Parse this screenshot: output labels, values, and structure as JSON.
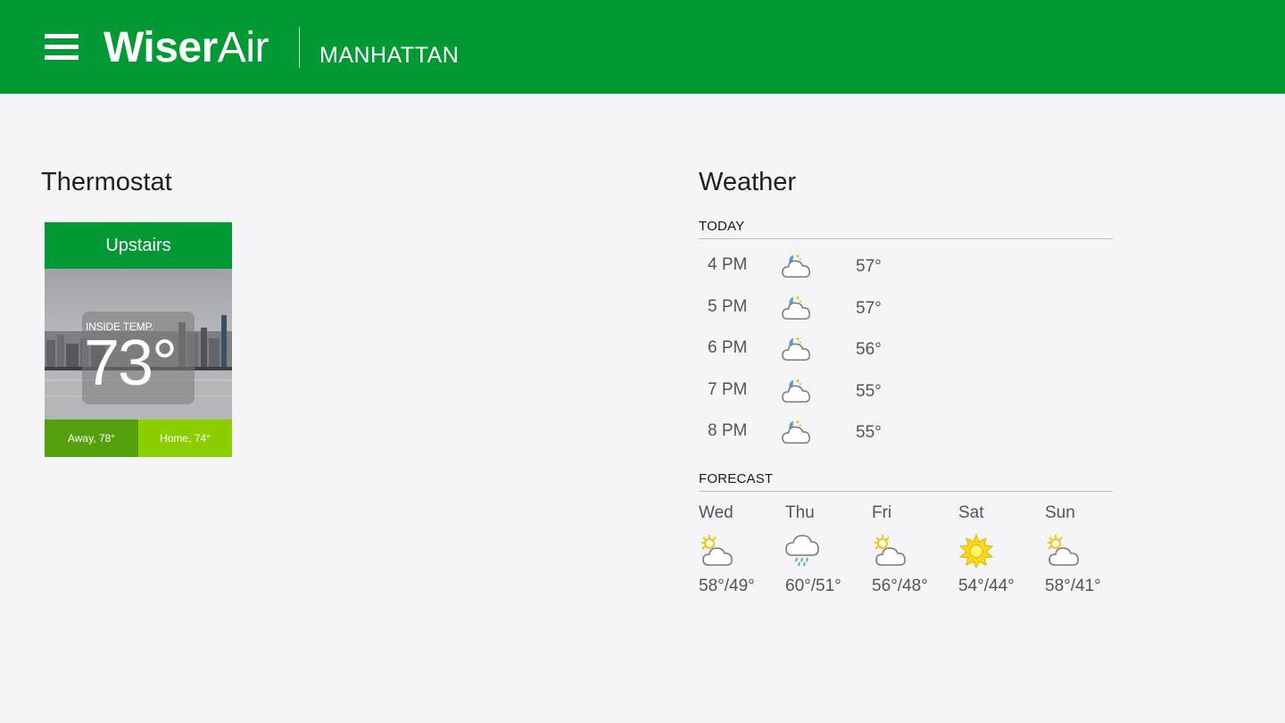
{
  "header": {
    "brand_bold": "Wiser",
    "brand_light": "Air",
    "location": "MANHATTAN",
    "menu_icon": "hamburger-menu-icon"
  },
  "colors": {
    "header_green": "#009933",
    "away_green": "#55a10d",
    "home_green": "#8ccf00",
    "background": "#f5f4f6"
  },
  "thermostat": {
    "title": "Thermostat",
    "tile": {
      "name": "Upstairs",
      "inside_label": "INSIDE TEMP.",
      "inside_temp": "73°",
      "away_label": "Away, 78°",
      "home_label": "Home, 74°"
    }
  },
  "weather": {
    "title": "Weather",
    "today_label": "TODAY",
    "hourly": [
      {
        "time": "4 PM",
        "icon": "night-partly-cloudy-icon",
        "temp": "57°"
      },
      {
        "time": "5 PM",
        "icon": "night-partly-cloudy-icon",
        "temp": "57°"
      },
      {
        "time": "6 PM",
        "icon": "night-partly-cloudy-icon",
        "temp": "56°"
      },
      {
        "time": "7 PM",
        "icon": "night-partly-cloudy-icon",
        "temp": "55°"
      },
      {
        "time": "8 PM",
        "icon": "night-partly-cloudy-icon",
        "temp": "55°"
      }
    ],
    "forecast_label": "FORECAST",
    "forecast": [
      {
        "day": "Wed",
        "icon": "partly-sunny-icon",
        "temp": "58°/49°"
      },
      {
        "day": "Thu",
        "icon": "rain-cloud-icon",
        "temp": "60°/51°"
      },
      {
        "day": "Fri",
        "icon": "partly-sunny-icon",
        "temp": "56°/48°"
      },
      {
        "day": "Sat",
        "icon": "sunny-icon",
        "temp": "54°/44°"
      },
      {
        "day": "Sun",
        "icon": "partly-sunny-icon",
        "temp": "58°/41°"
      }
    ]
  }
}
